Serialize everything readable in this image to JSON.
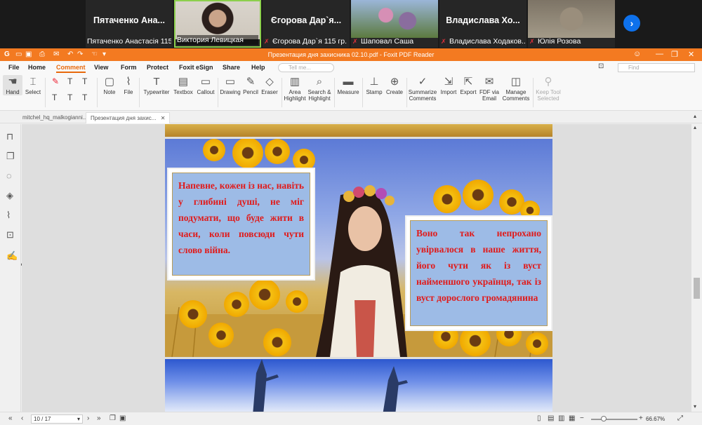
{
  "participants": [
    {
      "big_name": "Пятаченко Ана...",
      "caption": "Пятаченко Анастасія 115",
      "muted": false,
      "has_video": false
    },
    {
      "big_name": "",
      "caption": "Виктория Левицкая",
      "muted": false,
      "has_video": true,
      "active": true
    },
    {
      "big_name": "Єгорова Дар`я...",
      "caption": "Єгорова Дар`я 115 гр.",
      "muted": true,
      "has_video": false
    },
    {
      "big_name": "",
      "caption": "Шаповал Саша",
      "muted": true,
      "has_video": true
    },
    {
      "big_name": "Владислава Хо...",
      "caption": "Владислава Ходаков...",
      "muted": true,
      "has_video": false
    },
    {
      "big_name": "",
      "caption": "Юлія Розова",
      "muted": true,
      "has_video": true
    }
  ],
  "next_label": "›",
  "window": {
    "title": "Презентация дня захисника 02.10.pdf - Foxit PDF Reader",
    "controls": [
      "☺",
      "—",
      "❐",
      "✕"
    ]
  },
  "menu": [
    "File",
    "Home",
    "Comment",
    "View",
    "Form",
    "Protect",
    "Foxit eSign",
    "Share",
    "Help"
  ],
  "active_menu": "Comment",
  "tell_me_placeholder": "Tell me...",
  "find_placeholder": "Find",
  "tools": {
    "hand": "Hand",
    "select": "Select",
    "note": "Note",
    "file": "File",
    "typewriter": "Typewriter",
    "textbox": "Textbox",
    "callout": "Callout",
    "drawing": "Drawing",
    "pencil": "Pencil",
    "eraser": "Eraser",
    "area_highlight": [
      "Area",
      "Highlight"
    ],
    "search_highlight": [
      "Search &",
      "Highlight"
    ],
    "measure": "Measure",
    "stamp": "Stamp",
    "create": "Create",
    "summarize": [
      "Summarize",
      "Comments"
    ],
    "import": "Import",
    "export": "Export",
    "fdf": [
      "FDF via",
      "Email"
    ],
    "manage": [
      "Manage",
      "Comments"
    ],
    "keep_tool": [
      "Keep Tool",
      "Selected"
    ]
  },
  "tabs": [
    {
      "label": "mitchel_hq_malkogianni...",
      "active": false
    },
    {
      "label": "Презентация дня захис...",
      "active": true
    }
  ],
  "slide": {
    "left_text": "Напевне, кожен із нас, навіть у глибині душі, не міг подумати, що буде жити в часи, коли повсюди чути слово війна.",
    "right_text": "Воно так непрохано увірвалося в наше життя, його чути як із вуст найменшого українця, так із вуст дорослого громадянина"
  },
  "status": {
    "page": "10 / 17",
    "zoom": "66.67%"
  },
  "colors": {
    "foxit_orange": "#f37a21",
    "accent_orange": "#e8690c",
    "slide_text_red": "#e01b1b",
    "zoom_blue": "#0e71eb"
  }
}
